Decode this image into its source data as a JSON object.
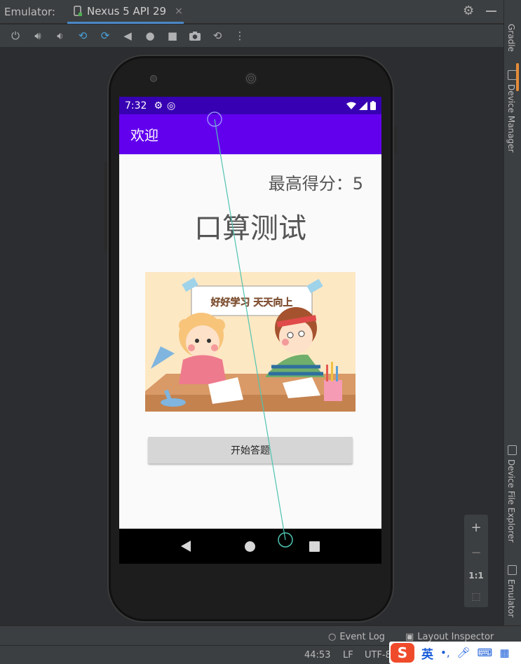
{
  "ide": {
    "panel_title": "Emulator:",
    "tab_label": "Nexus 5 API 29",
    "tab_close": "×",
    "toolbar_icons": [
      "power-icon",
      "volume-up-icon",
      "volume-down-icon",
      "rotate-left-icon",
      "rotate-right-icon",
      "back-icon",
      "home-icon",
      "overview-icon",
      "screenshot-icon",
      "snapshot-icon",
      "more-icon"
    ],
    "right_tools": [
      {
        "label": "Gradle"
      },
      {
        "label": "Device Manager"
      },
      {
        "label": "Device File Explorer"
      },
      {
        "label": "Emulator"
      }
    ],
    "zoom": {
      "plus": "+",
      "minus": "−",
      "one_to_one": "1:1"
    },
    "bottom_tools": [
      {
        "label": "Event Log"
      },
      {
        "label": "Layout Inspector"
      }
    ],
    "status": {
      "position": "44:53",
      "line_sep": "LF",
      "encoding": "UTF-8"
    },
    "ime": {
      "lang": "英",
      "punct": "•,"
    }
  },
  "device": {
    "status_time": "7:32",
    "app_title": "欢迎",
    "high_score_label": "最高得分：",
    "high_score_value": "5",
    "heading": "口算测试",
    "banner_text": "好好学习 天天向上",
    "start_button": "开始答题"
  },
  "colors": {
    "status_bar": "#3700b3",
    "app_bar": "#6200ee",
    "button": "#d6d6d6",
    "trace": "#4fc3b0"
  }
}
